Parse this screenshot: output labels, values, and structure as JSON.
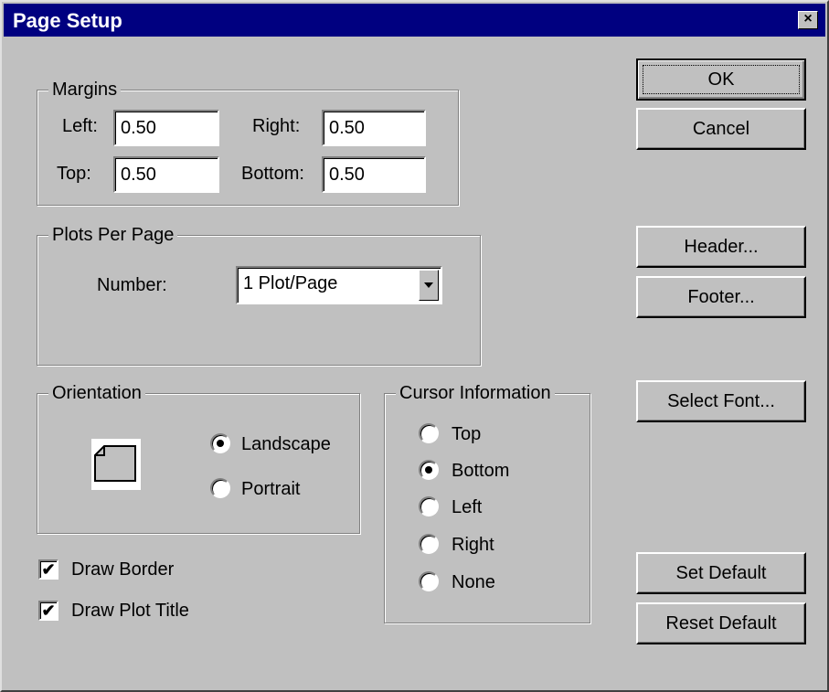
{
  "window": {
    "title": "Page Setup",
    "close_glyph": "×"
  },
  "margins": {
    "group_label": "Margins",
    "left_label": "Left:",
    "left_value": "0.50",
    "right_label": "Right:",
    "right_value": "0.50",
    "top_label": "Top:",
    "top_value": "0.50",
    "bottom_label": "Bottom:",
    "bottom_value": "0.50"
  },
  "plots": {
    "group_label": "Plots Per Page",
    "number_label": "Number:",
    "number_value": "1 Plot/Page"
  },
  "orientation": {
    "group_label": "Orientation",
    "options": [
      {
        "label": "Landscape",
        "selected": true
      },
      {
        "label": "Portrait",
        "selected": false
      }
    ],
    "icon": "landscape-page-icon"
  },
  "cursor": {
    "group_label": "Cursor Information",
    "options": [
      {
        "label": "Top",
        "selected": false
      },
      {
        "label": "Bottom",
        "selected": true
      },
      {
        "label": "Left",
        "selected": false
      },
      {
        "label": "Right",
        "selected": false
      },
      {
        "label": "None",
        "selected": false
      }
    ]
  },
  "checkboxes": {
    "draw_border": {
      "label": "Draw Border",
      "checked": true
    },
    "draw_plot_title": {
      "label": "Draw Plot Title",
      "checked": true
    }
  },
  "buttons": {
    "ok": "OK",
    "cancel": "Cancel",
    "header": "Header...",
    "footer": "Footer...",
    "select_font": "Select Font...",
    "set_default": "Set Default",
    "reset_default": "Reset Default"
  },
  "check_glyph": "✔"
}
